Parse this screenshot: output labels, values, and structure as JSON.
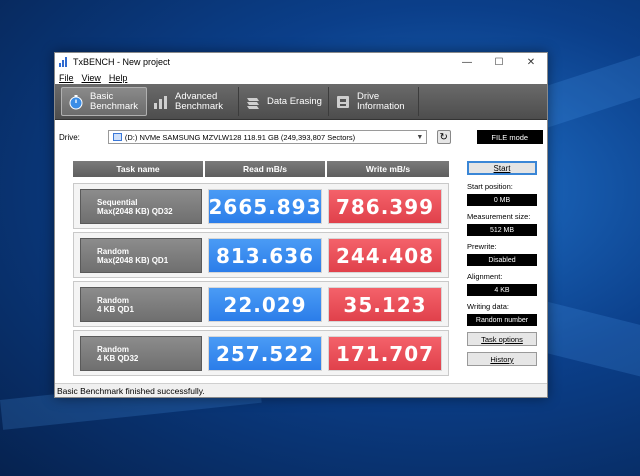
{
  "window": {
    "title": "TxBENCH - New project",
    "controls": {
      "minimize": "—",
      "maximize": "☐",
      "close": "✕"
    }
  },
  "menu": [
    {
      "label": "File",
      "key": "F"
    },
    {
      "label": "View",
      "key": "V"
    },
    {
      "label": "Help",
      "key": "H"
    }
  ],
  "toolbar": {
    "basic": {
      "line1": "Basic",
      "line2": "Benchmark",
      "icon": "stopwatch-icon"
    },
    "advanced": {
      "line1": "Advanced",
      "line2": "Benchmark",
      "icon": "bar-chart-icon"
    },
    "erasing": {
      "line1": "Data Erasing",
      "icon": "eraser-icon"
    },
    "info": {
      "line1": "Drive",
      "line2": "Information",
      "icon": "drive-info-icon"
    }
  },
  "drive": {
    "label": "Drive:",
    "selected": "(D:) NVMe SAMSUNG MZVLW128   118.91 GB (249,393,807 Sectors)",
    "mode": "FILE mode"
  },
  "headers": {
    "task": "Task name",
    "read": "Read mB/s",
    "write": "Write mB/s"
  },
  "rows": [
    {
      "line1": "Sequential",
      "line2": "Max(2048 KB) QD32",
      "read": "2665.893",
      "write": "786.399"
    },
    {
      "line1": "Random",
      "line2": "Max(2048 KB) QD1",
      "read": "813.636",
      "write": "244.408"
    },
    {
      "line1": "Random",
      "line2": "4 KB QD1",
      "read": "22.029",
      "write": "35.123"
    },
    {
      "line1": "Random",
      "line2": "4 KB QD32",
      "read": "257.522",
      "write": "171.707"
    }
  ],
  "side": {
    "start": "Start",
    "start_position_label": "Start position:",
    "start_position": "0 MB",
    "measurement_size_label": "Measurement size:",
    "measurement_size": "512 MB",
    "prewrite_label": "Prewrite:",
    "prewrite": "Disabled",
    "alignment_label": "Alignment:",
    "alignment": "4 KB",
    "writing_data_label": "Writing data:",
    "writing_data": "Random number",
    "task_options": "Task options",
    "history": "History"
  },
  "status": "Basic Benchmark finished successfully.",
  "colors": {
    "read": "#2b7de9",
    "write": "#e0414b",
    "toolbar": "#555555"
  }
}
